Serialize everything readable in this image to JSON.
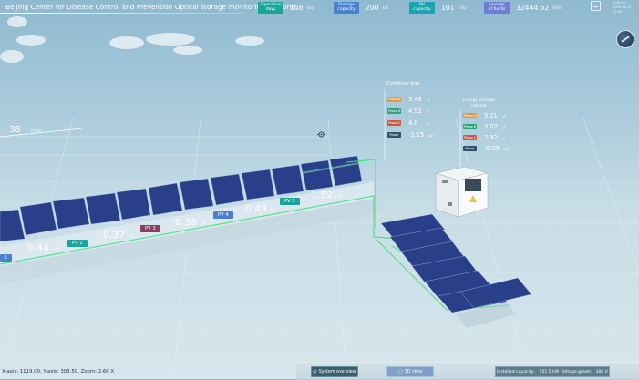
{
  "header": {
    "title": "Beijing Center for Disease Control and Prevention Optical storage monitoring platform.",
    "datetime_line1": "0:00:00",
    "datetime_line2": "2025.10.10 00:00"
  },
  "stats": [
    {
      "label": "Operation days",
      "value": "158",
      "unit": "day",
      "color": "#1ba49a"
    },
    {
      "label": "Storage capacity",
      "value": "200",
      "unit": "kW",
      "color": "#4b7fd0"
    },
    {
      "label": "PV capacity",
      "value": "101",
      "unit": "kWp",
      "color": "#1aa3b0"
    },
    {
      "label": "savings of funds",
      "value": "32444.52",
      "unit": "RMB",
      "color": "#6d7ed6"
    }
  ],
  "scene": {
    "marker_value": "38",
    "marker_unit": "kW/m²",
    "pv_strings": [
      {
        "tag": "1",
        "value": "",
        "color": "#4b7fd0"
      },
      {
        "tag": "PV 2",
        "value": "0.44",
        "color": "#1ba49a"
      },
      {
        "tag": "PV 3",
        "value": "0.37",
        "color": "#8a3f63"
      },
      {
        "tag": "PV 4",
        "value": "0.38",
        "color": "#4b7fd0"
      },
      {
        "tag": "PV 5",
        "value": "0.49",
        "color": "#1ba49a"
      },
      {
        "tag": "",
        "value": "1.52",
        "color": "#1ba49a"
      }
    ],
    "pv_unit": "kW",
    "combiner_box": {
      "title": "Combiner box",
      "rows": [
        {
          "label": "Phase A",
          "value": "3.48",
          "unit": "A",
          "color": "#e69a3a"
        },
        {
          "label": "Phase B",
          "value": "4.92",
          "unit": "A",
          "color": "#2fa27a"
        },
        {
          "label": "Phase C",
          "value": "4.8",
          "unit": "A",
          "color": "#d0573f"
        },
        {
          "label": "Power",
          "value": "-2.15",
          "unit": "kW",
          "color": "#35506b"
        }
      ]
    },
    "storage_cabinet": {
      "title_line1": "Energy storage",
      "title_line2": "cabinet",
      "rows": [
        {
          "label": "Phase A",
          "value": "3.01",
          "unit": "A",
          "color": "#e69a3a"
        },
        {
          "label": "Phase B",
          "value": "3.02",
          "unit": "A",
          "color": "#2fa27a"
        },
        {
          "label": "Phase C",
          "value": "2.92",
          "unit": "A",
          "color": "#d0573f"
        },
        {
          "label": "Power",
          "value": "-0.05",
          "unit": "kW",
          "color": "#35506b"
        }
      ]
    }
  },
  "footer": {
    "overview_label": "System overview",
    "view3d_label": "3D view",
    "installed_capacity": "Installed capacity：  101.5 kW",
    "voltage_grade": "Voltage grade：  380 V",
    "coords": "X-axis: 1119.00, Y-axis: 303.50, Zoom: 2.60 X"
  }
}
